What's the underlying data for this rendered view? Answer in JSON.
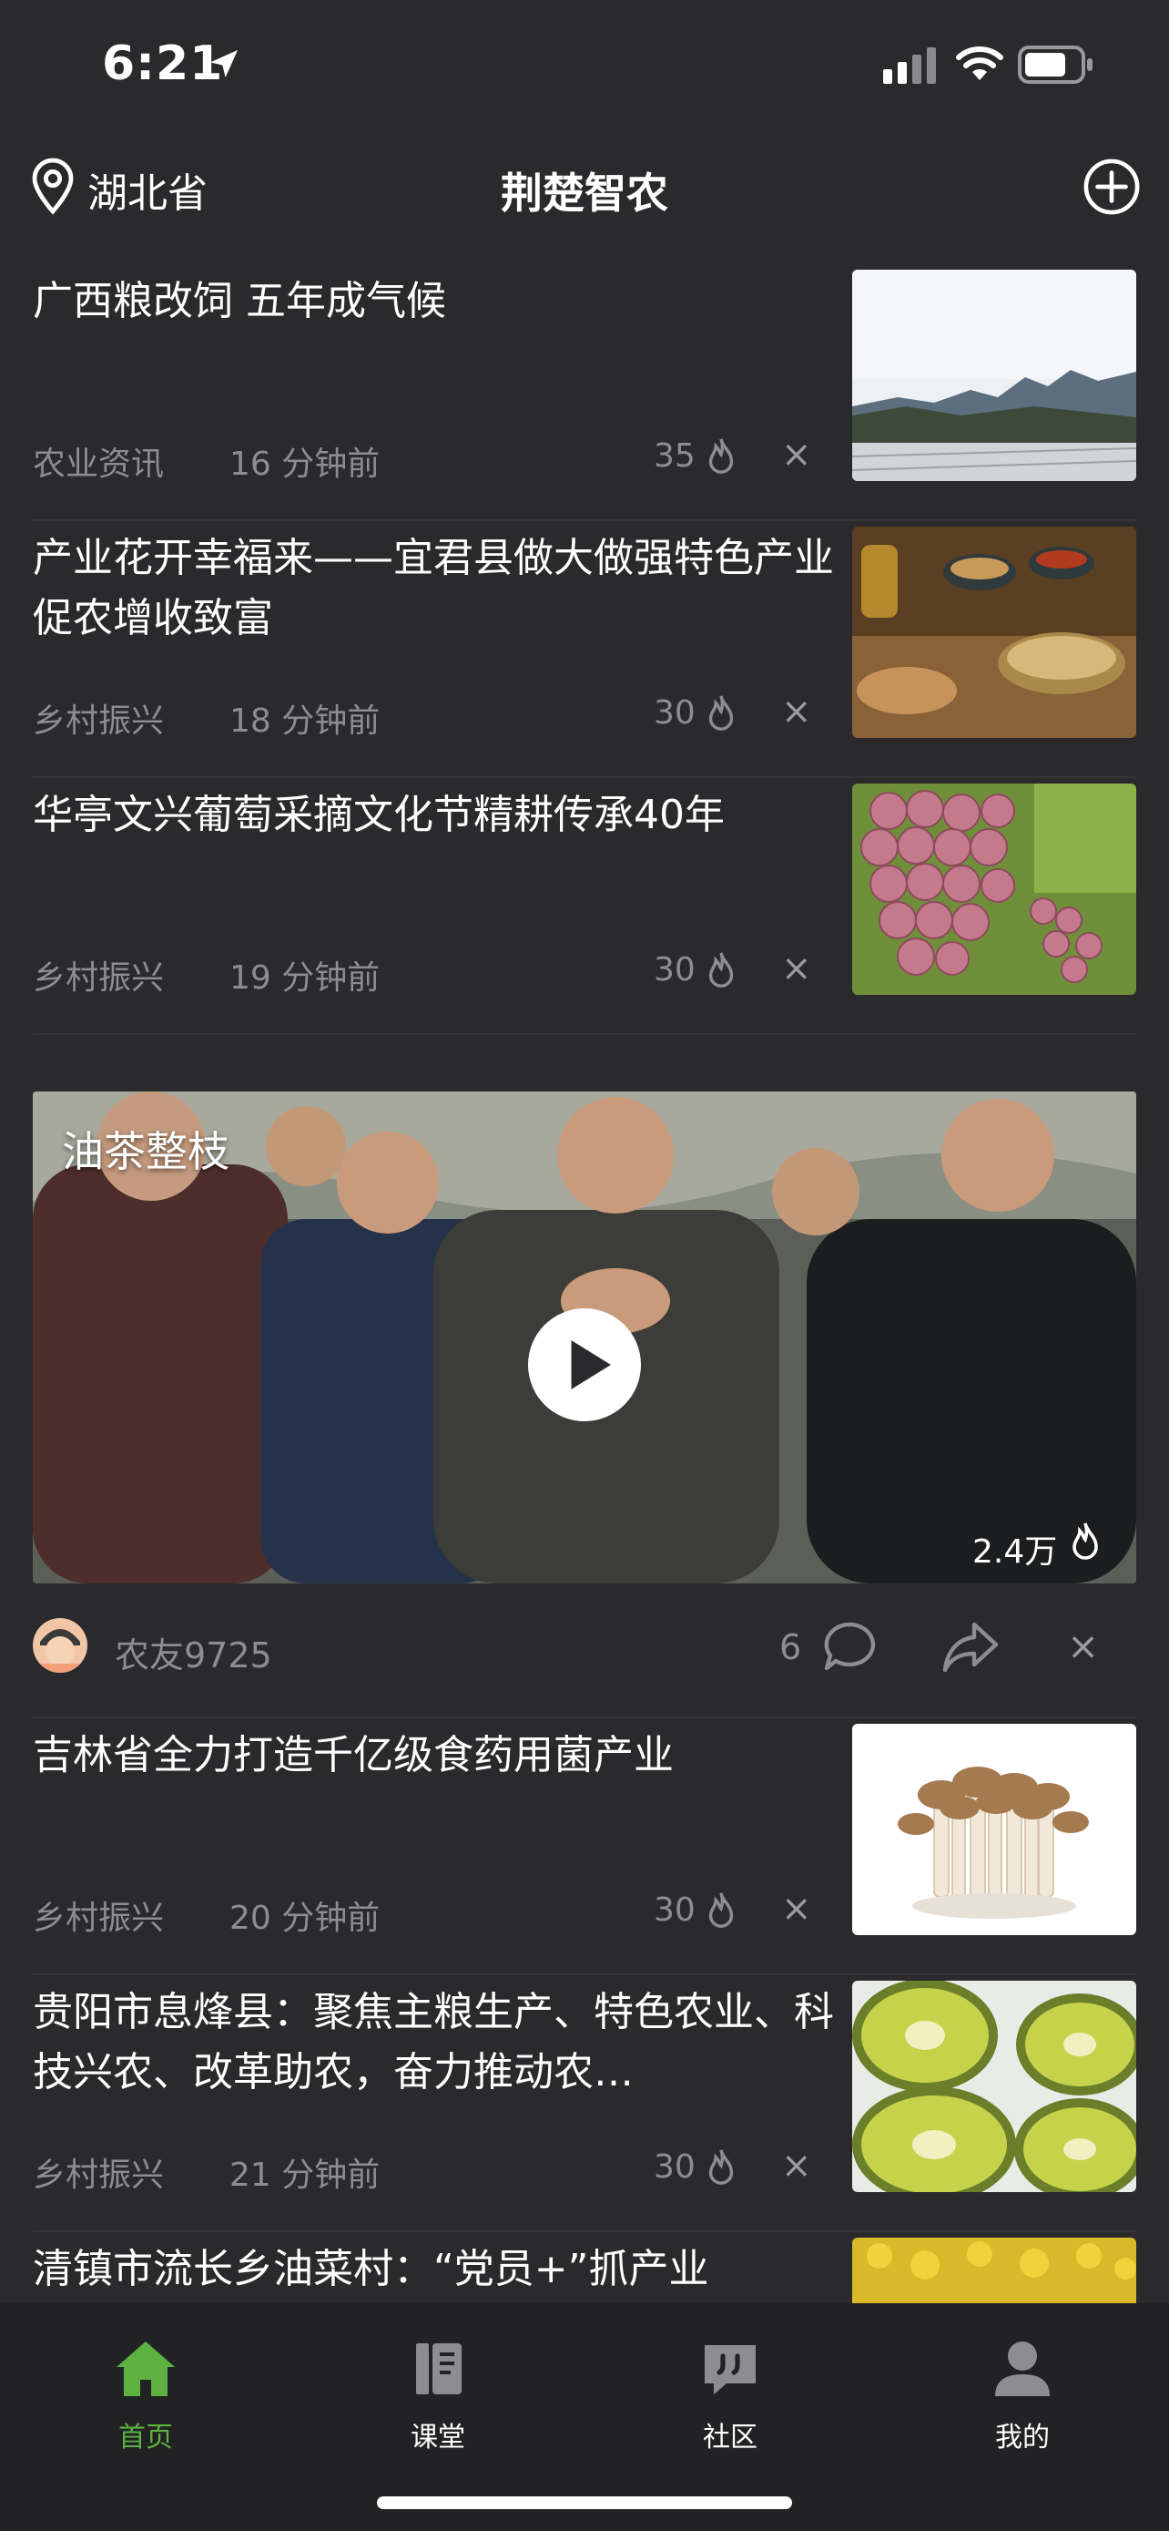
{
  "status_bar": {
    "time": "6:21"
  },
  "header": {
    "location": "湖北省",
    "title": "荆楚智农"
  },
  "feed": {
    "articles": [
      {
        "title": "广西粮改饲 五年成气候",
        "category": "农业资讯",
        "time_ago": "16 分钟前",
        "hot": "35"
      },
      {
        "title": "产业花开幸福来——宜君县做大做强特色产业促农增收致富",
        "category": "乡村振兴",
        "time_ago": "18 分钟前",
        "hot": "30"
      },
      {
        "title": "华亭文兴葡萄采摘文化节精耕传承40年",
        "category": "乡村振兴",
        "time_ago": "19 分钟前",
        "hot": "30"
      }
    ],
    "video": {
      "title": "油茶整枝",
      "views": "2.4万",
      "author": "农友9725",
      "comments": "6"
    },
    "articles2": [
      {
        "title": "吉林省全力打造千亿级食药用菌产业",
        "category": "乡村振兴",
        "time_ago": "20 分钟前",
        "hot": "30"
      },
      {
        "title": "贵阳市息烽县：聚焦主粮生产、特色农业、科技兴农、改革助农，奋力推动农…",
        "category": "乡村振兴",
        "time_ago": "21 分钟前",
        "hot": "30"
      },
      {
        "title": "清镇市流长乡油菜村：“党员+”抓产业"
      }
    ]
  },
  "close_symbol": "×",
  "tabs": [
    {
      "label": "首页",
      "icon": "home-icon",
      "active": true
    },
    {
      "label": "课堂",
      "icon": "book-icon",
      "active": false
    },
    {
      "label": "社区",
      "icon": "chat-quote-icon",
      "active": false
    },
    {
      "label": "我的",
      "icon": "person-icon",
      "active": false
    }
  ],
  "colors": {
    "accent": "#5cb141",
    "background": "#2a2a2c",
    "muted_text": "#8d8d90"
  }
}
